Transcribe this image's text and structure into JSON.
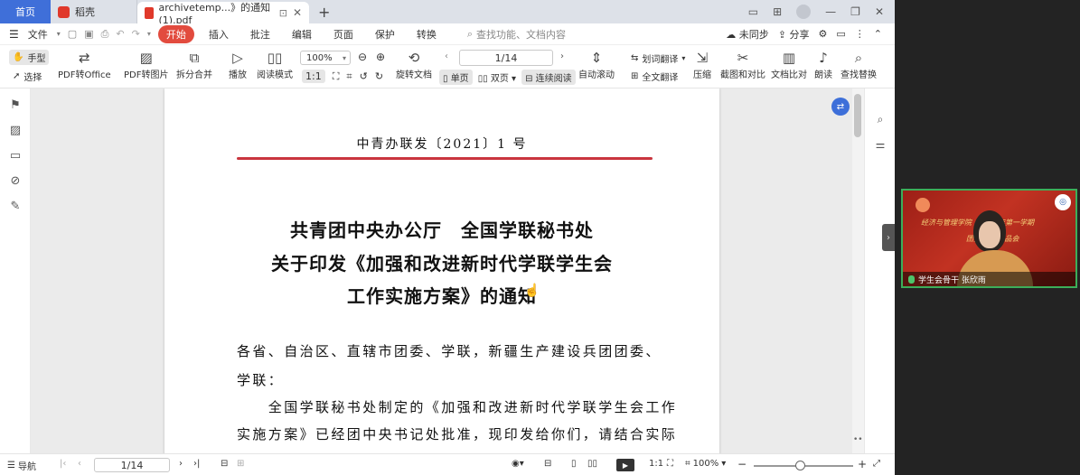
{
  "tabs": {
    "home": "首页",
    "docer": "稻壳",
    "active_doc": "archivetemp...》的通知(1).pdf"
  },
  "menu": {
    "file": "文件",
    "start": "开始",
    "items": [
      "插入",
      "批注",
      "编辑",
      "页面",
      "保护",
      "转换"
    ],
    "search_placeholder": "查找功能、文档内容",
    "sync": "未同步",
    "share": "分享"
  },
  "toolbar": {
    "hand": "手型",
    "select": "选择",
    "pdf_to_office": "PDF转Office",
    "pdf_to_image": "PDF转图片",
    "split_merge": "拆分合并",
    "play": "播放",
    "read_mode": "阅读模式",
    "zoom": "100%",
    "rotate": "旋转文档",
    "page_display": "1/14",
    "single": "单页",
    "double": "双页",
    "continuous": "连续阅读",
    "autoscroll": "自动滚动",
    "word_translate": "划词翻译",
    "full_translate": "全文翻译",
    "compress": "压缩",
    "screenshot_compare": "截图和对比",
    "doc_compare": "文档比对",
    "read_aloud": "朗读",
    "find_replace": "查找替换"
  },
  "document": {
    "doc_number": "中青办联发〔2021〕1 号",
    "title_lines": [
      "共青团中央办公厅　全国学联秘书处",
      "关于印发《加强和改进新时代学联学生会",
      "工作实施方案》的通知"
    ],
    "body_lines": [
      "各省、自治区、直辖市团委、学联，新疆生产建设兵团团委、",
      "学联：",
      "　　全国学联秘书处制定的《加强和改进新时代学联学生会工作",
      "实施方案》已经团中央书记处批准，现印发给你们，请结合实际"
    ]
  },
  "statusbar": {
    "nav": "导航",
    "page": "1/14",
    "zoom": "100%"
  },
  "video": {
    "banner": "经济与管理学院 …… 学年第一学期",
    "banner2": "团委…… 精品会",
    "caption": "学生会骨干 张欣雨"
  },
  "colors": {
    "accent": "#3f6fd9",
    "start_button": "#e24b3e",
    "red_rule": "#c9353e",
    "video_border": "#3cae5a"
  }
}
